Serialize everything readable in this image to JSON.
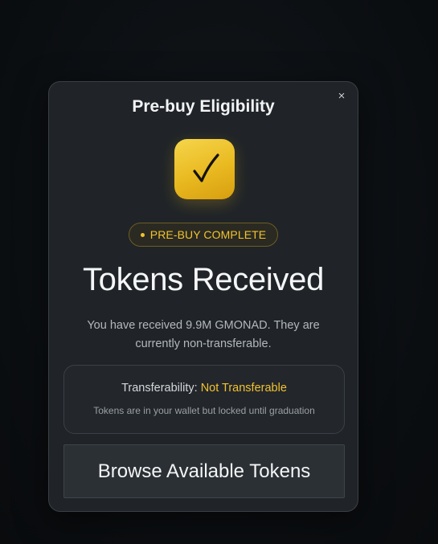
{
  "modal": {
    "title": "Pre-buy Eligibility",
    "close_icon": "×",
    "status_icon": "checkmark-icon",
    "badge_label": "PRE-BUY COMPLETE",
    "headline": "Tokens Received",
    "description": "You have received 9.9M GMONAD. They are currently non-transferable.",
    "info": {
      "transferability_label": "Transferability:",
      "transferability_value": "Not Transferable",
      "note": "Tokens are in your wallet but locked until graduation"
    },
    "browse_button_label": "Browse Available Tokens"
  },
  "colors": {
    "accent": "#f2c230",
    "modal_bg": "#202428",
    "page_bg": "#0c0f12"
  }
}
